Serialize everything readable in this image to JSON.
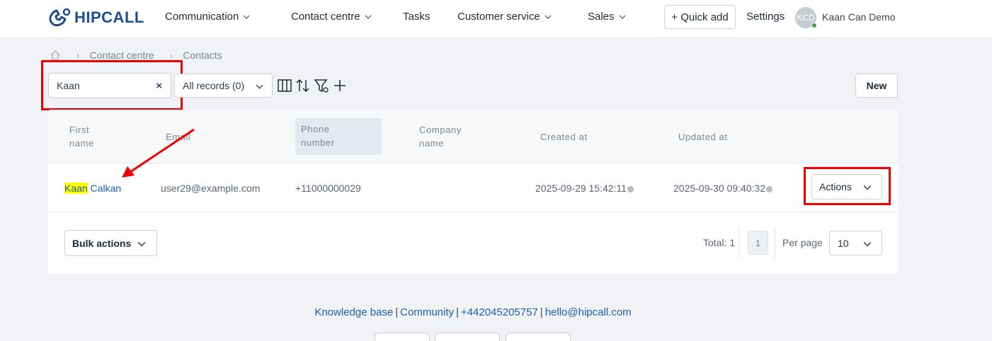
{
  "header": {
    "logo_text": "HIPCALL",
    "nav": [
      {
        "label": "Communication",
        "has_dropdown": true
      },
      {
        "label": "Contact centre",
        "has_dropdown": true
      },
      {
        "label": "Tasks",
        "has_dropdown": false
      },
      {
        "label": "Customer service",
        "has_dropdown": true
      },
      {
        "label": "Sales",
        "has_dropdown": true
      }
    ],
    "quick_add": "+ Quick add",
    "settings": "Settings",
    "avatar_initials": "KCD",
    "user_name": "Kaan Can Demo"
  },
  "breadcrumb": {
    "items": [
      "Contact centre",
      "Contacts"
    ]
  },
  "toolbar": {
    "search_value": "Kaan",
    "clear_icon": "×",
    "records_select": "All records (0)",
    "new_button": "New"
  },
  "table": {
    "headers": {
      "first_name": [
        "First",
        "name"
      ],
      "email": "Email",
      "phone": [
        "Phone",
        "number"
      ],
      "company": [
        "Company",
        "name"
      ],
      "created": "Created at",
      "updated": "Updated at"
    },
    "rows": [
      {
        "first_name_highlight": "Kaan",
        "first_name_rest": " Calkan",
        "email": "user29@example.com",
        "phone": "+11000000029",
        "company": "",
        "created": "2025-09-29 15:42:11",
        "updated": "2025-09-30 09:40:32",
        "actions": "Actions"
      }
    ]
  },
  "footer_bar": {
    "bulk_actions": "Bulk actions",
    "total": "Total: 1",
    "page": "1",
    "per_page_label": "Per page",
    "per_page_value": "10"
  },
  "footer": {
    "links": [
      "Knowledge base",
      "Community",
      "+442045205757",
      "hello@hipcall.com"
    ]
  },
  "colors": {
    "annotation_red": "#f00000",
    "highlight": "#ffff00",
    "link_blue": "#1f5fa5",
    "brand_blue": "#1f4e8c"
  }
}
